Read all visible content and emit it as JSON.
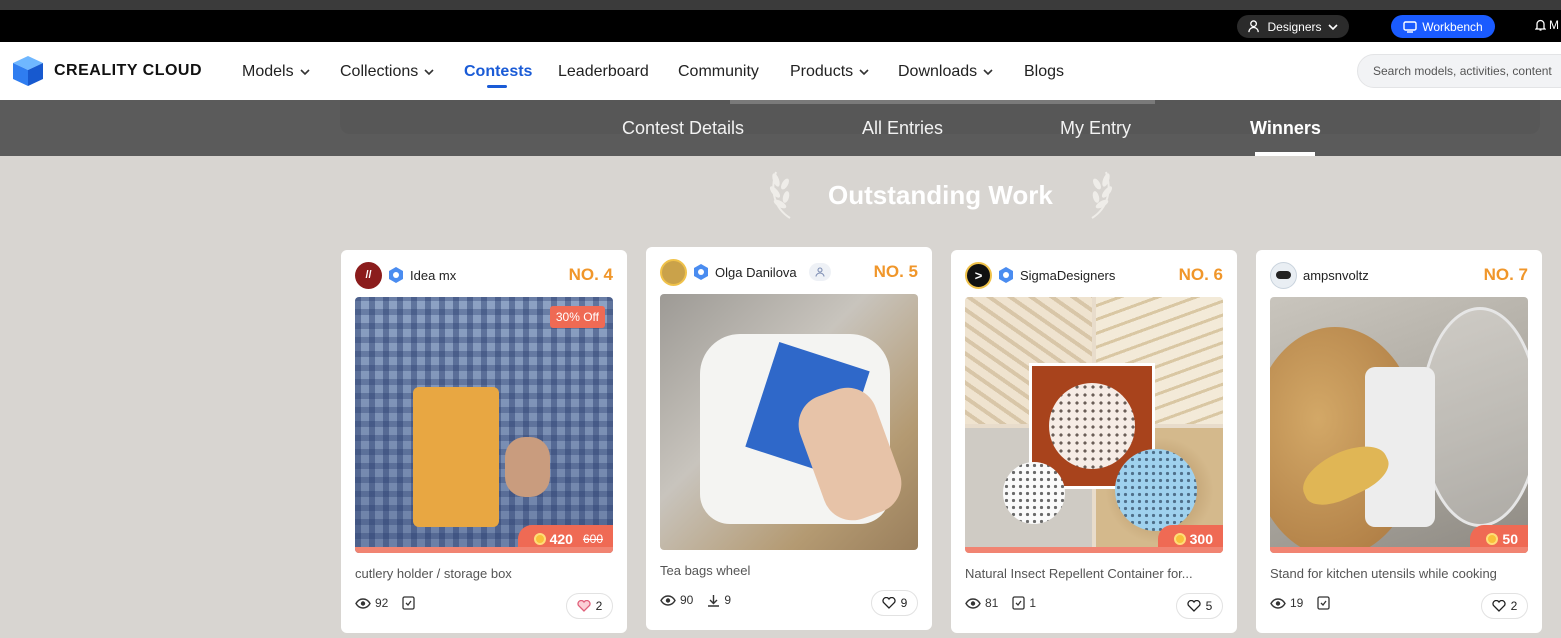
{
  "topbar": {
    "designers_label": "Designers",
    "workbench_label": "Workbench",
    "more_label": "M"
  },
  "nav": {
    "brand": "CREALITY CLOUD",
    "items": [
      {
        "label": "Models"
      },
      {
        "label": "Collections"
      },
      {
        "label": "Contests"
      },
      {
        "label": "Leaderboard"
      },
      {
        "label": "Community"
      },
      {
        "label": "Products"
      },
      {
        "label": "Downloads"
      },
      {
        "label": "Blogs"
      }
    ],
    "search_placeholder": "Search models, activities, content"
  },
  "subnav": {
    "tabs": [
      {
        "label": "Contest Details"
      },
      {
        "label": "All Entries"
      },
      {
        "label": "My Entry"
      },
      {
        "label": "Winners"
      }
    ],
    "active": "Winners"
  },
  "section_title": "Outstanding Work",
  "cards": [
    {
      "user": "Idea mx",
      "rank": "NO. 4",
      "discount": "30% Off",
      "price": "420",
      "old_price": "600",
      "title": "cutlery holder / storage box",
      "views": "92",
      "likes": "2"
    },
    {
      "user": "Olga Danilova",
      "rank": "NO. 5",
      "title": "Tea bags wheel",
      "views": "90",
      "downloads": "9",
      "likes": "9"
    },
    {
      "user": "SigmaDesigners",
      "rank": "NO. 6",
      "price": "300",
      "title": "Natural Insect Repellent Container for...",
      "views": "81",
      "collects": "1",
      "likes": "5"
    },
    {
      "user": "ampsnvoltz",
      "rank": "NO. 7",
      "price": "50",
      "title": "Stand for kitchen utensils while cooking",
      "views": "19",
      "likes": "2"
    }
  ],
  "colors": {
    "accent_blue": "#1a5bd6",
    "rank_orange": "#f0962a",
    "price_red": "#ef6a54",
    "page_bg": "#d8d5d1"
  }
}
